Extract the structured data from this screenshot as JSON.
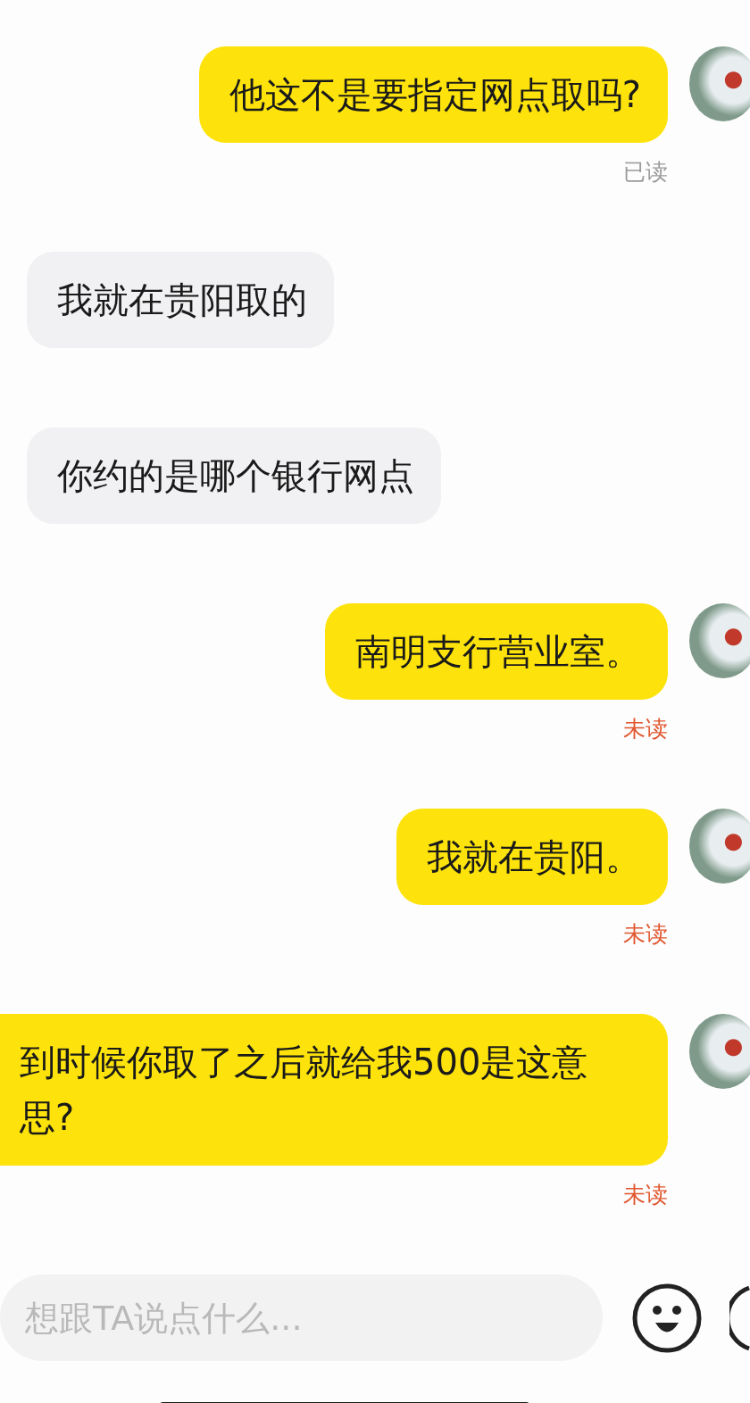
{
  "messages": [
    {
      "kind": "outgoing",
      "text": "他这不是要指定网点取吗?",
      "status": "已读",
      "read": true
    },
    {
      "kind": "incoming",
      "text": "我就在贵阳取的"
    },
    {
      "kind": "incoming",
      "text": "你约的是哪个银行网点"
    },
    {
      "kind": "outgoing",
      "text": "南明支行营业室。",
      "status": "未读",
      "read": false
    },
    {
      "kind": "outgoing",
      "text": "我就在贵阳。",
      "status": "未读",
      "read": false
    },
    {
      "kind": "outgoing",
      "text": "到时候你取了之后就给我500是这意思?",
      "status": "未读",
      "read": false
    }
  ],
  "composer": {
    "placeholder": "想跟TA说点什么..."
  }
}
